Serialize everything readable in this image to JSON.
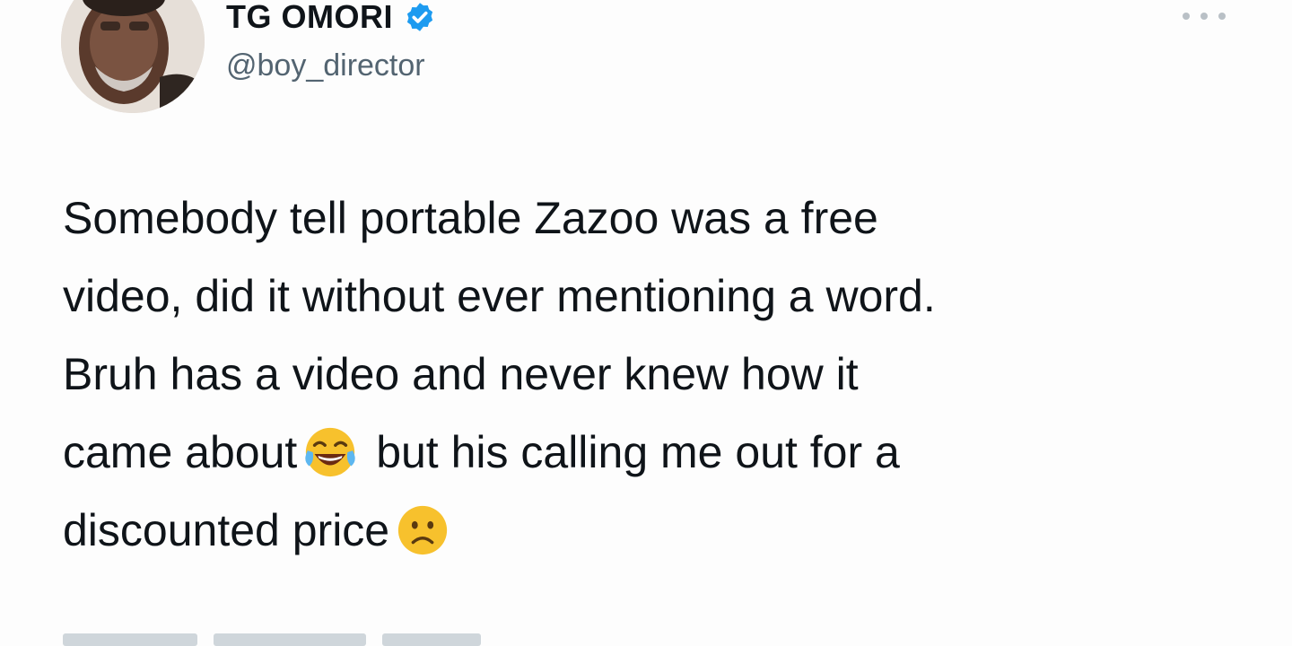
{
  "author": {
    "display_name": "TG OMORI",
    "handle": "@boy_director",
    "verified": true,
    "avatar": "profile-photo"
  },
  "tweet": {
    "line1": "Somebody tell portable Zazoo was a free",
    "line2": "video, did it without ever mentioning a word.",
    "line3": "Bruh has a video and never knew how it",
    "line4_before_emoji": "came about",
    "line4_after_emoji": "but his calling me out for a",
    "line5": "discounted price",
    "emojis": [
      "face-with-tears-of-joy",
      "frowning-face"
    ]
  },
  "icons": {
    "verified": "verified-badge-icon",
    "more": "more-options-icon"
  },
  "colors": {
    "text": "#0f1419",
    "secondary": "#536471",
    "verified_blue": "#1d9bf0",
    "emoji_yellow": "#f7c12d"
  }
}
